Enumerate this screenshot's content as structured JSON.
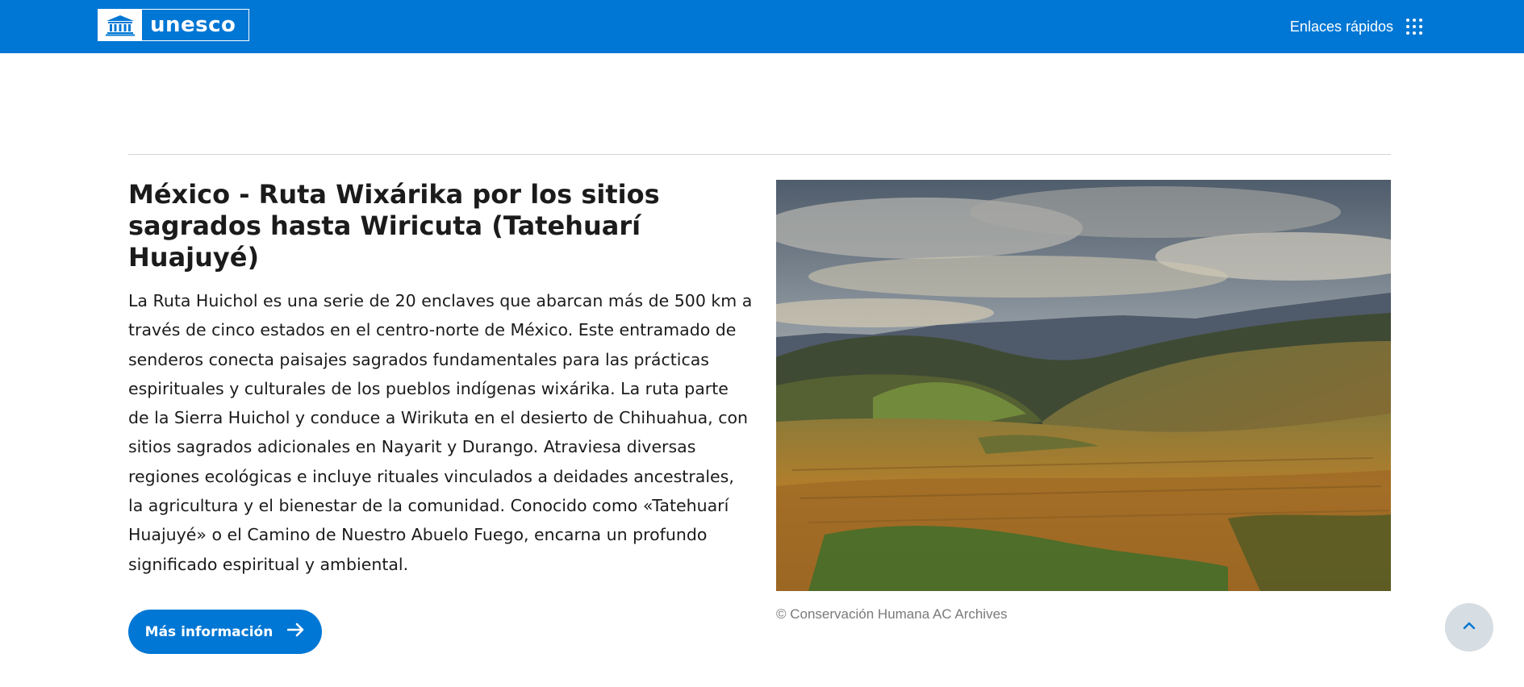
{
  "header": {
    "logo_text": "unesco",
    "quick_links_label": "Enlaces rápidos",
    "background_color": "#0077d4"
  },
  "article": {
    "title": "México - Ruta Wixárika por los sitios sagrados hasta Wiricuta (Tatehuarí Huajuyé)",
    "description": "La Ruta Huichol es una serie de 20 enclaves que abarcan más de 500 km a través de cinco estados en el centro-norte de México. Este entramado de senderos conecta paisajes sagrados fundamentales para las prácticas espirituales y culturales de los pueblos indígenas wixárika. La ruta parte de la Sierra Huichol y conduce a Wirikuta en el desierto de Chihuahua, con sitios sagrados adicionales en Nayarit y Durango. Atraviesa diversas regiones ecológicas e incluye rituales vinculados a deidades ancestrales, la agricultura y el bienestar de la comunidad. Conocido como «Tatehuarí Huajuyé» o el Camino de Nuestro Abuelo Fuego, encarna un profundo significado espiritual y ambiental.",
    "button_label": "Más información",
    "image_credit": "© Conservación Humana AC Archives"
  },
  "icons": {
    "quick_links": "grid-dots-icon",
    "button_arrow": "arrow-right-icon",
    "back_to_top": "chevron-up-icon",
    "logo_emblem": "temple-emblem-icon"
  },
  "colors": {
    "accent": "#0077d4",
    "text": "#1b1b1b",
    "muted": "#7a7a7a",
    "back_to_top_bg": "#d6dde3"
  }
}
